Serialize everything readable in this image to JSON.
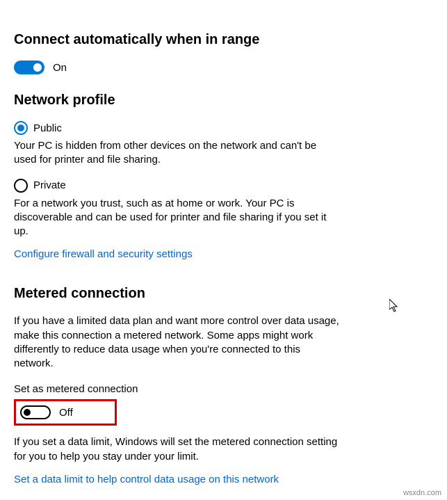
{
  "connect": {
    "title": "Connect automatically when in range",
    "toggle_state": "On"
  },
  "network_profile": {
    "title": "Network profile",
    "public": {
      "label": "Public",
      "description": "Your PC is hidden from other devices on the network and can't be used for printer and file sharing."
    },
    "private": {
      "label": "Private",
      "description": "For a network you trust, such as at home or work. Your PC is discoverable and can be used for printer and file sharing if you set it up."
    },
    "configure_link": "Configure firewall and security settings"
  },
  "metered": {
    "title": "Metered connection",
    "description": "If you have a limited data plan and want more control over data usage, make this connection a metered network. Some apps might work differently to reduce data usage when you're connected to this network.",
    "set_label": "Set as metered connection",
    "toggle_state": "Off",
    "limit_description": "If you set a data limit, Windows will set the metered connection setting for you to help you stay under your limit.",
    "data_limit_link": "Set a data limit to help control data usage on this network"
  },
  "watermark": "wsxdn.com"
}
